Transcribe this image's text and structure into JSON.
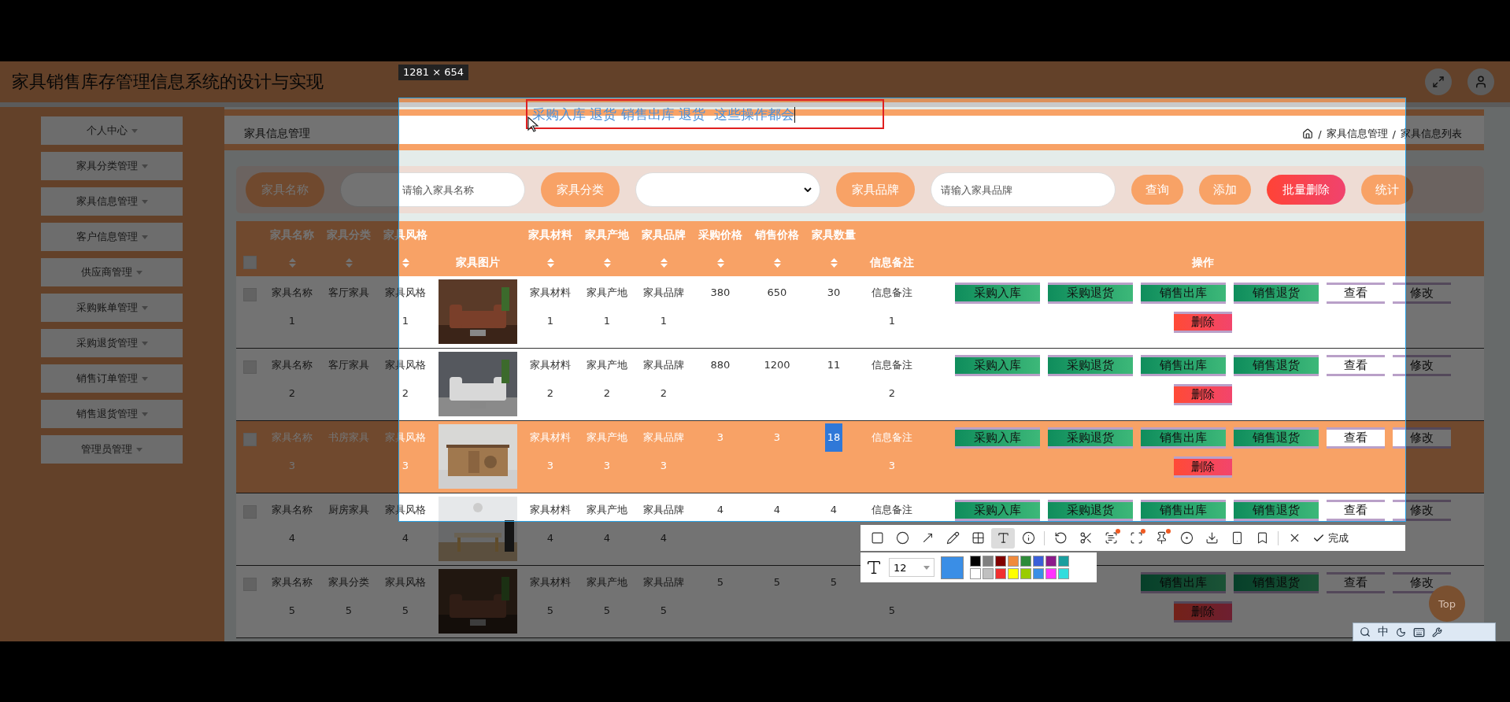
{
  "header": {
    "title": "家具销售库存管理信息系统的设计与实现"
  },
  "sidebar": {
    "items": [
      {
        "label": "个人中心"
      },
      {
        "label": "家具分类管理"
      },
      {
        "label": "家具信息管理"
      },
      {
        "label": "客户信息管理"
      },
      {
        "label": "供应商管理"
      },
      {
        "label": "采购账单管理"
      },
      {
        "label": "采购退货管理"
      },
      {
        "label": "销售订单管理"
      },
      {
        "label": "销售退货管理"
      },
      {
        "label": "管理员管理"
      }
    ]
  },
  "breadcrumb": {
    "title": "家具信息管理",
    "path": [
      {
        "separator": "/",
        "label": "家具信息管理"
      },
      {
        "separator": "/",
        "label": "家具信息列表"
      }
    ]
  },
  "search": {
    "fields": [
      {
        "kind": "input",
        "label": "家具名称",
        "placeholder": "请输入家具名称"
      },
      {
        "kind": "select",
        "label": "家具分类"
      },
      {
        "kind": "input",
        "label": "家具品牌",
        "placeholder": "请输入家具品牌"
      }
    ],
    "buttons": [
      {
        "label": "查询",
        "kind": "normal"
      },
      {
        "label": "添加",
        "kind": "normal"
      },
      {
        "label": "批量删除",
        "kind": "danger"
      },
      {
        "label": "统计",
        "kind": "normal"
      }
    ]
  },
  "table": {
    "header_checked": false,
    "columns": [
      {
        "label": "家具名称",
        "sortable": true
      },
      {
        "label": "家具分类",
        "sortable": true
      },
      {
        "label": "家具风格",
        "sortable": true
      },
      {
        "label": "家具图片",
        "sortable": false
      },
      {
        "label": "家具材料",
        "sortable": true
      },
      {
        "label": "家具产地",
        "sortable": true
      },
      {
        "label": "家具品牌",
        "sortable": true
      },
      {
        "label": "采购价格",
        "sortable": true
      },
      {
        "label": "销售价格",
        "sortable": true
      },
      {
        "label": "家具数量",
        "sortable": true
      },
      {
        "label": "信息备注",
        "sortable": false
      },
      {
        "label": "操作",
        "sortable": false
      }
    ],
    "rows": [
      {
        "selected": false,
        "checked": false,
        "quantity_highlighted": false,
        "cells": [
          "家具名称1",
          "客厅家具",
          "家具风格1",
          {
            "kind": "picture"
          },
          "家具材料1",
          "家具产地1",
          "家具品牌1",
          "380",
          "650",
          "30",
          "信息备注1"
        ],
        "actions": [
          {
            "label": "采购入库",
            "kind": "green"
          },
          {
            "label": "采购退货",
            "kind": "green"
          },
          {
            "label": "销售出库",
            "kind": "green"
          },
          {
            "label": "销售退货",
            "kind": "green"
          },
          {
            "label": "查看",
            "kind": "plain"
          },
          {
            "label": "修改",
            "kind": "plain"
          },
          {
            "label": "删除",
            "kind": "danger"
          }
        ]
      },
      {
        "selected": false,
        "checked": false,
        "quantity_highlighted": false,
        "cells": [
          "家具名称2",
          "客厅家具",
          "家具风格2",
          {
            "kind": "picture"
          },
          "家具材料2",
          "家具产地2",
          "家具品牌2",
          "880",
          "1200",
          "11",
          "信息备注2"
        ],
        "actions": [
          {
            "label": "采购入库",
            "kind": "green"
          },
          {
            "label": "采购退货",
            "kind": "green"
          },
          {
            "label": "销售出库",
            "kind": "green"
          },
          {
            "label": "销售退货",
            "kind": "green"
          },
          {
            "label": "查看",
            "kind": "plain"
          },
          {
            "label": "修改",
            "kind": "plain"
          },
          {
            "label": "删除",
            "kind": "danger"
          }
        ]
      },
      {
        "selected": true,
        "checked": false,
        "quantity_highlighted": true,
        "cells": [
          "家具名称3",
          "书房家具",
          "家具风格3",
          {
            "kind": "picture"
          },
          "家具材料3",
          "家具产地3",
          "家具品牌3",
          "3",
          "3",
          "18",
          "信息备注3"
        ],
        "actions": [
          {
            "label": "采购入库",
            "kind": "green"
          },
          {
            "label": "采购退货",
            "kind": "green"
          },
          {
            "label": "销售出库",
            "kind": "green"
          },
          {
            "label": "销售退货",
            "kind": "green"
          },
          {
            "label": "查看",
            "kind": "plain"
          },
          {
            "label": "修改",
            "kind": "plain"
          },
          {
            "label": "删除",
            "kind": "danger"
          }
        ]
      },
      {
        "selected": false,
        "checked": false,
        "quantity_highlighted": false,
        "cells": [
          "家具名称4",
          "厨房家具",
          "家具风格4",
          {
            "kind": "picture"
          },
          "家具材料4",
          "家具产地4",
          "家具品牌4",
          "4",
          "4",
          "4",
          "信息备注"
        ],
        "actions": [
          {
            "label": "采购入库",
            "kind": "green"
          },
          {
            "label": "采购退货",
            "kind": "green"
          },
          {
            "label": "销售出库",
            "kind": "green"
          },
          {
            "label": "销售退货",
            "kind": "green"
          },
          {
            "label": "查看",
            "kind": "plain"
          },
          {
            "label": "修改",
            "kind": "plain"
          }
        ]
      },
      {
        "selected": false,
        "checked": false,
        "quantity_highlighted": false,
        "cells": [
          "家具名称5",
          "家具分类5",
          "家具风格5",
          {
            "kind": "picture"
          },
          "家具材料5",
          "家具产地5",
          "家具品牌5",
          "5",
          "5",
          "5",
          "\n5"
        ],
        "actions": [
          {
            "label": "销售出库",
            "kind": "green"
          },
          {
            "label": "销售退货",
            "kind": "green"
          },
          {
            "label": "查看",
            "kind": "plain"
          },
          {
            "label": "修改",
            "kind": "plain"
          },
          {
            "label": "删除",
            "kind": "danger"
          }
        ]
      }
    ]
  },
  "top_button": "Top",
  "capture": {
    "size_label": "1281 × 654",
    "annotation": "采购入库 退货 销售出库 退货  这些操作都会",
    "tools": [
      {
        "selected": false,
        "dot": false
      },
      {
        "selected": false,
        "dot": false
      },
      {
        "selected": false,
        "dot": false
      },
      {
        "selected": false,
        "dot": false
      },
      {
        "selected": false,
        "dot": false
      },
      {
        "selected": true,
        "dot": false
      },
      {
        "selected": false,
        "dot": false
      },
      {
        "selected": false,
        "dot": false
      },
      {
        "selected": false,
        "dot": false
      },
      {
        "selected": false,
        "dot": true
      },
      {
        "selected": false,
        "dot": true
      },
      {
        "selected": false,
        "dot": true
      },
      {
        "selected": false,
        "dot": false
      },
      {
        "selected": false,
        "dot": false
      },
      {
        "selected": false,
        "dot": false
      },
      {
        "selected": false,
        "dot": false
      },
      {
        "selected": false,
        "dot": false
      }
    ],
    "done_label": "完成",
    "font_size": "12",
    "current_color": {
      "color": "#3a8ee6"
    },
    "palette": [
      {
        "color": "#000000"
      },
      {
        "color": "#808080"
      },
      {
        "color": "#800000"
      },
      {
        "color": "#f08a3c"
      },
      {
        "color": "#2e8b3a"
      },
      {
        "color": "#3a5fd8"
      },
      {
        "color": "#8b1a8b"
      },
      {
        "color": "#1a9e9e"
      },
      {
        "color": "#ffffff"
      },
      {
        "color": "#c0c0c0"
      },
      {
        "color": "#f03030"
      },
      {
        "color": "#ffff00"
      },
      {
        "color": "#99cc00"
      },
      {
        "color": "#3a8ee6"
      },
      {
        "color": "#ff33ff"
      },
      {
        "color": "#33dddd"
      }
    ]
  },
  "tray": {
    "ime": "中"
  }
}
